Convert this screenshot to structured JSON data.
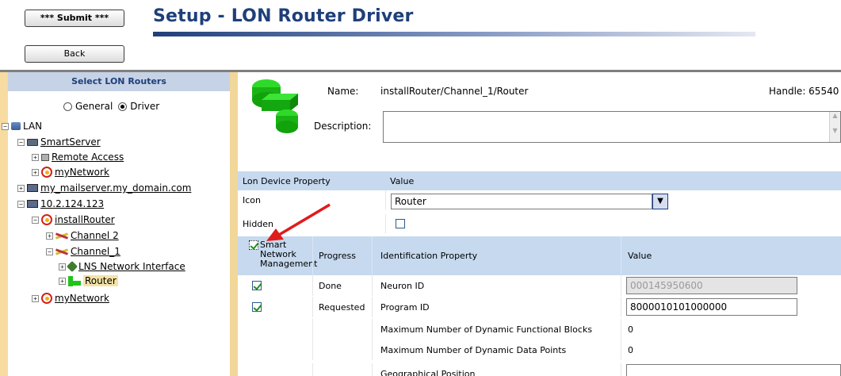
{
  "toolbar": {
    "submit_label": "*** Submit ***",
    "back_label": "Back"
  },
  "header": {
    "title": "Setup - LON Router Driver"
  },
  "left_panel": {
    "heading": "Select LON Routers",
    "radio_general": "General",
    "radio_driver": "Driver",
    "tree": {
      "lan": "LAN",
      "smartserver": "SmartServer",
      "remote_access": "Remote Access",
      "mynetwork_a": "myNetwork",
      "mailserver": "my_mailserver.my_domain.com",
      "ip": "10.2.124.123",
      "install_router": "installRouter",
      "channel2": "Channel 2",
      "channel1": "Channel_1",
      "lns": "LNS Network Interface",
      "router": "Router",
      "mynetwork_b": "myNetwork"
    }
  },
  "details": {
    "name_label": "Name:",
    "name_value": "installRouter/Channel_1/Router",
    "handle_label": "Handle: 65540",
    "description_label": "Description:"
  },
  "props": {
    "col_property": "Lon Device Property",
    "col_value": "Value",
    "icon_label": "Icon",
    "icon_value": "Router",
    "hidden_label": "Hidden"
  },
  "ident": {
    "col_smart": "Smart Network Management",
    "col_progress": "Progress",
    "col_property": "Identification Property",
    "col_value": "Value",
    "rows": [
      {
        "progress": "Done",
        "property": "Neuron ID",
        "value": "000145950600"
      },
      {
        "progress": "Requested",
        "property": "Program ID",
        "value": "8000010101000000"
      },
      {
        "progress": "",
        "property": "Maximum Number of Dynamic Functional Blocks",
        "value": "0"
      },
      {
        "progress": "",
        "property": "Maximum Number of Dynamic Data Points",
        "value": "0"
      },
      {
        "progress": "",
        "property": "Geographical Position",
        "value": ""
      }
    ]
  },
  "colors": {
    "title": "#1f3f7a",
    "header_bg": "#c6d9ef",
    "accent_arrow": "#e01b1b",
    "router_green": "#21c31b"
  },
  "icons": {
    "expand": "plus-box",
    "collapse": "minus-box"
  }
}
